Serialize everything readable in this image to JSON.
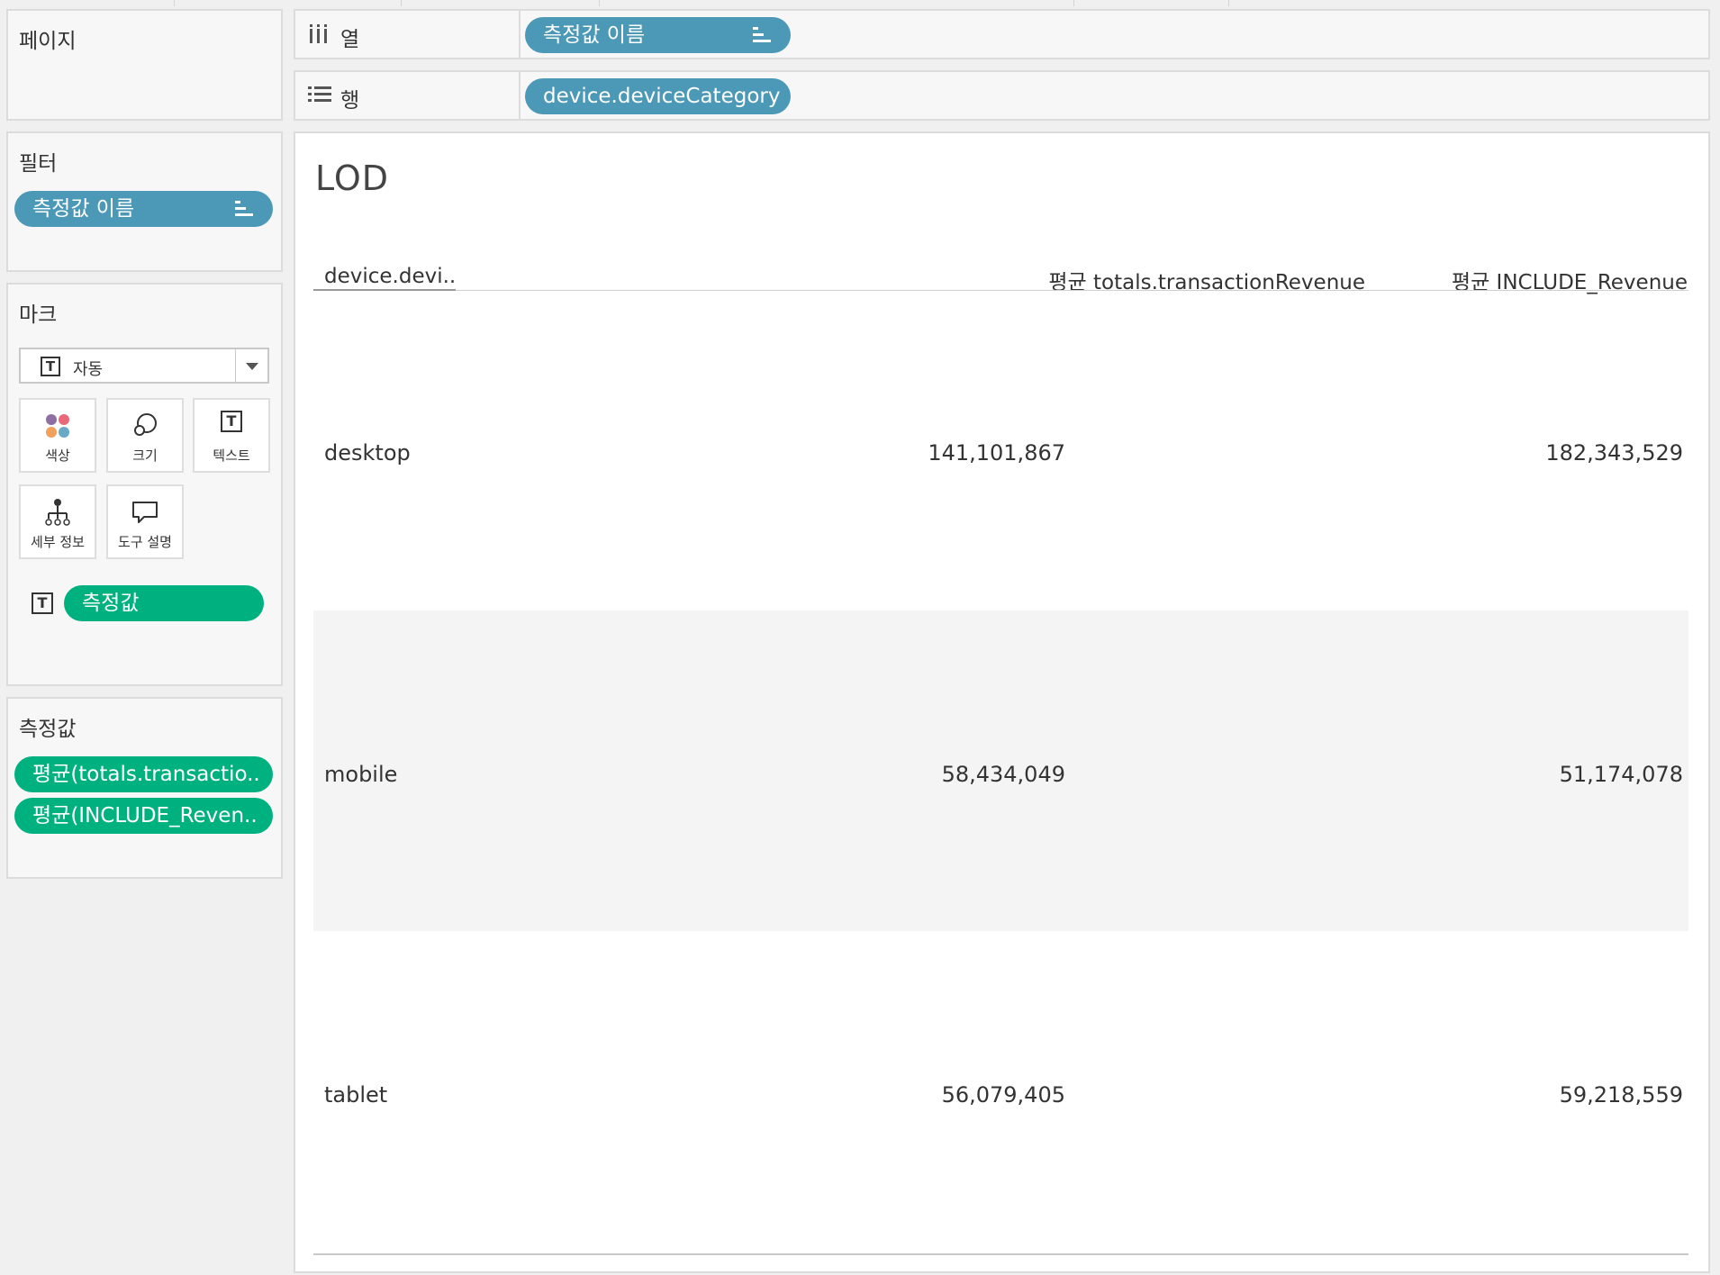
{
  "pages_card": {
    "title": "페이지"
  },
  "filters_card": {
    "title": "필터",
    "pill": "측정값 이름"
  },
  "marks_card": {
    "title": "마크",
    "mark_type": "자동",
    "buttons": [
      {
        "label": "색상",
        "icon": "color-dots-icon"
      },
      {
        "label": "크기",
        "icon": "size-icon"
      },
      {
        "label": "텍스트",
        "icon": "text-icon"
      },
      {
        "label": "세부 정보",
        "icon": "detail-icon"
      },
      {
        "label": "도구 설명",
        "icon": "tooltip-icon"
      }
    ],
    "text_pill": "측정값"
  },
  "measures_card": {
    "title": "측정값",
    "pills": [
      "평균(totals.transactio..",
      "평균(INCLUDE_Reven.."
    ]
  },
  "columns_shelf": {
    "label": "열",
    "pill": "측정값 이름"
  },
  "rows_shelf": {
    "label": "행",
    "pill": "device.deviceCategory"
  },
  "view": {
    "title": "LOD",
    "headers": [
      "device.devi..",
      "평균 totals.transactionRevenue",
      "평균 INCLUDE_Revenue"
    ],
    "rows": [
      {
        "category": "desktop",
        "avg_revenue": "141,101,867",
        "include_revenue": "182,343,529"
      },
      {
        "category": "mobile",
        "avg_revenue": "58,434,049",
        "include_revenue": "51,174,078"
      },
      {
        "category": "tablet",
        "avg_revenue": "56,079,405",
        "include_revenue": "59,218,559"
      }
    ]
  },
  "colors": {
    "blue_pill": "#4b98b7",
    "green_pill": "#00b180",
    "row_shade": "#f4f4f4"
  }
}
